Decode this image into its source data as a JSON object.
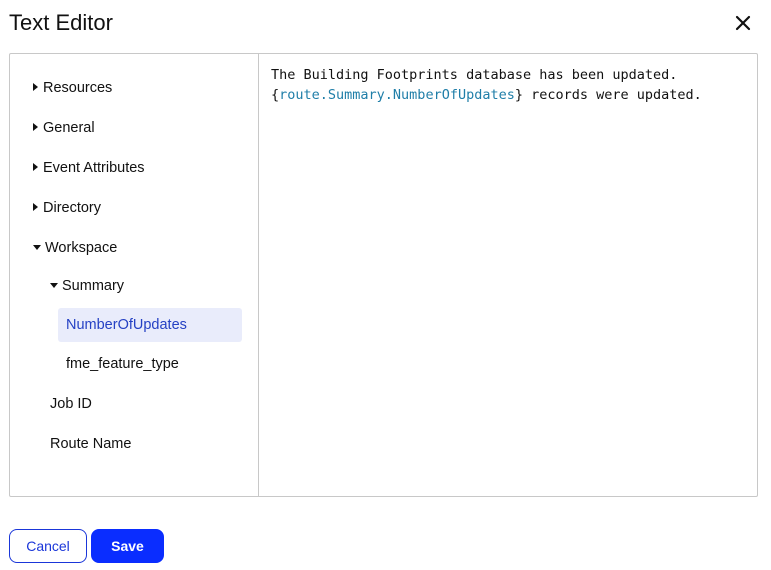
{
  "dialog": {
    "title": "Text Editor",
    "close_icon": "close-icon"
  },
  "tree": {
    "items": [
      {
        "label": "Resources",
        "state": "collapsed"
      },
      {
        "label": "General",
        "state": "collapsed"
      },
      {
        "label": "Event Attributes",
        "state": "collapsed"
      },
      {
        "label": "Directory",
        "state": "collapsed"
      },
      {
        "label": "Workspace",
        "state": "expanded"
      },
      {
        "label": "Summary",
        "state": "expanded"
      },
      {
        "label": "NumberOfUpdates",
        "state": "selected"
      },
      {
        "label": "fme_feature_type",
        "state": "leaf"
      },
      {
        "label": "Job ID",
        "state": "leaf"
      },
      {
        "label": "Route Name",
        "state": "leaf"
      }
    ]
  },
  "editor": {
    "line1": "The Building Footprints database has been updated.",
    "open_brace": "{",
    "variable": "route.Summary.NumberOfUpdates",
    "line2_rest": "} records were updated."
  },
  "colors": {
    "accent": "#0a2dff",
    "variable": "#1f7ea8",
    "selected_bg": "#e9ecfb"
  },
  "buttons": {
    "cancel_label": "Cancel",
    "save_label": "Save"
  }
}
